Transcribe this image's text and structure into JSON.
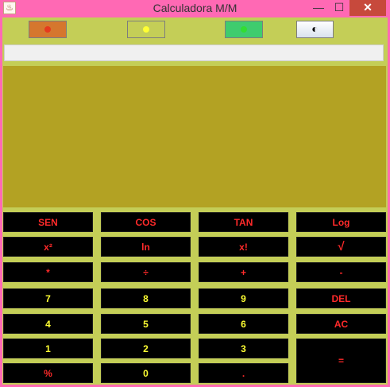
{
  "window": {
    "title": "Calculadora M/M",
    "min_label": "—",
    "max_label": "☐",
    "close_label": "✕",
    "app_icon": "♨"
  },
  "theme_buttons": [
    {
      "name": "orange-theme",
      "dot_color": "#e53a1e"
    },
    {
      "name": "yellow-theme",
      "dot_color": "#ffff33"
    },
    {
      "name": "green-theme",
      "dot_color": "#33dd33"
    },
    {
      "name": "contrast-theme",
      "icon": "◐"
    }
  ],
  "entry": {
    "value": ""
  },
  "display": {
    "value": ""
  },
  "keys": {
    "sen": "SEN",
    "cos": "COS",
    "tan": "TAN",
    "log": "Log",
    "square": "x²",
    "ln": "ln",
    "factorial": "x!",
    "sqrt": "√",
    "multiply": "*",
    "divide": "÷",
    "plus": "+",
    "minus": "-",
    "seven": "7",
    "eight": "8",
    "nine": "9",
    "del": "DEL",
    "four": "4",
    "five": "5",
    "six": "6",
    "ac": "AC",
    "one": "1",
    "two": "2",
    "three": "3",
    "equals": "=",
    "percent": "%",
    "zero": "0",
    "dot": "."
  }
}
